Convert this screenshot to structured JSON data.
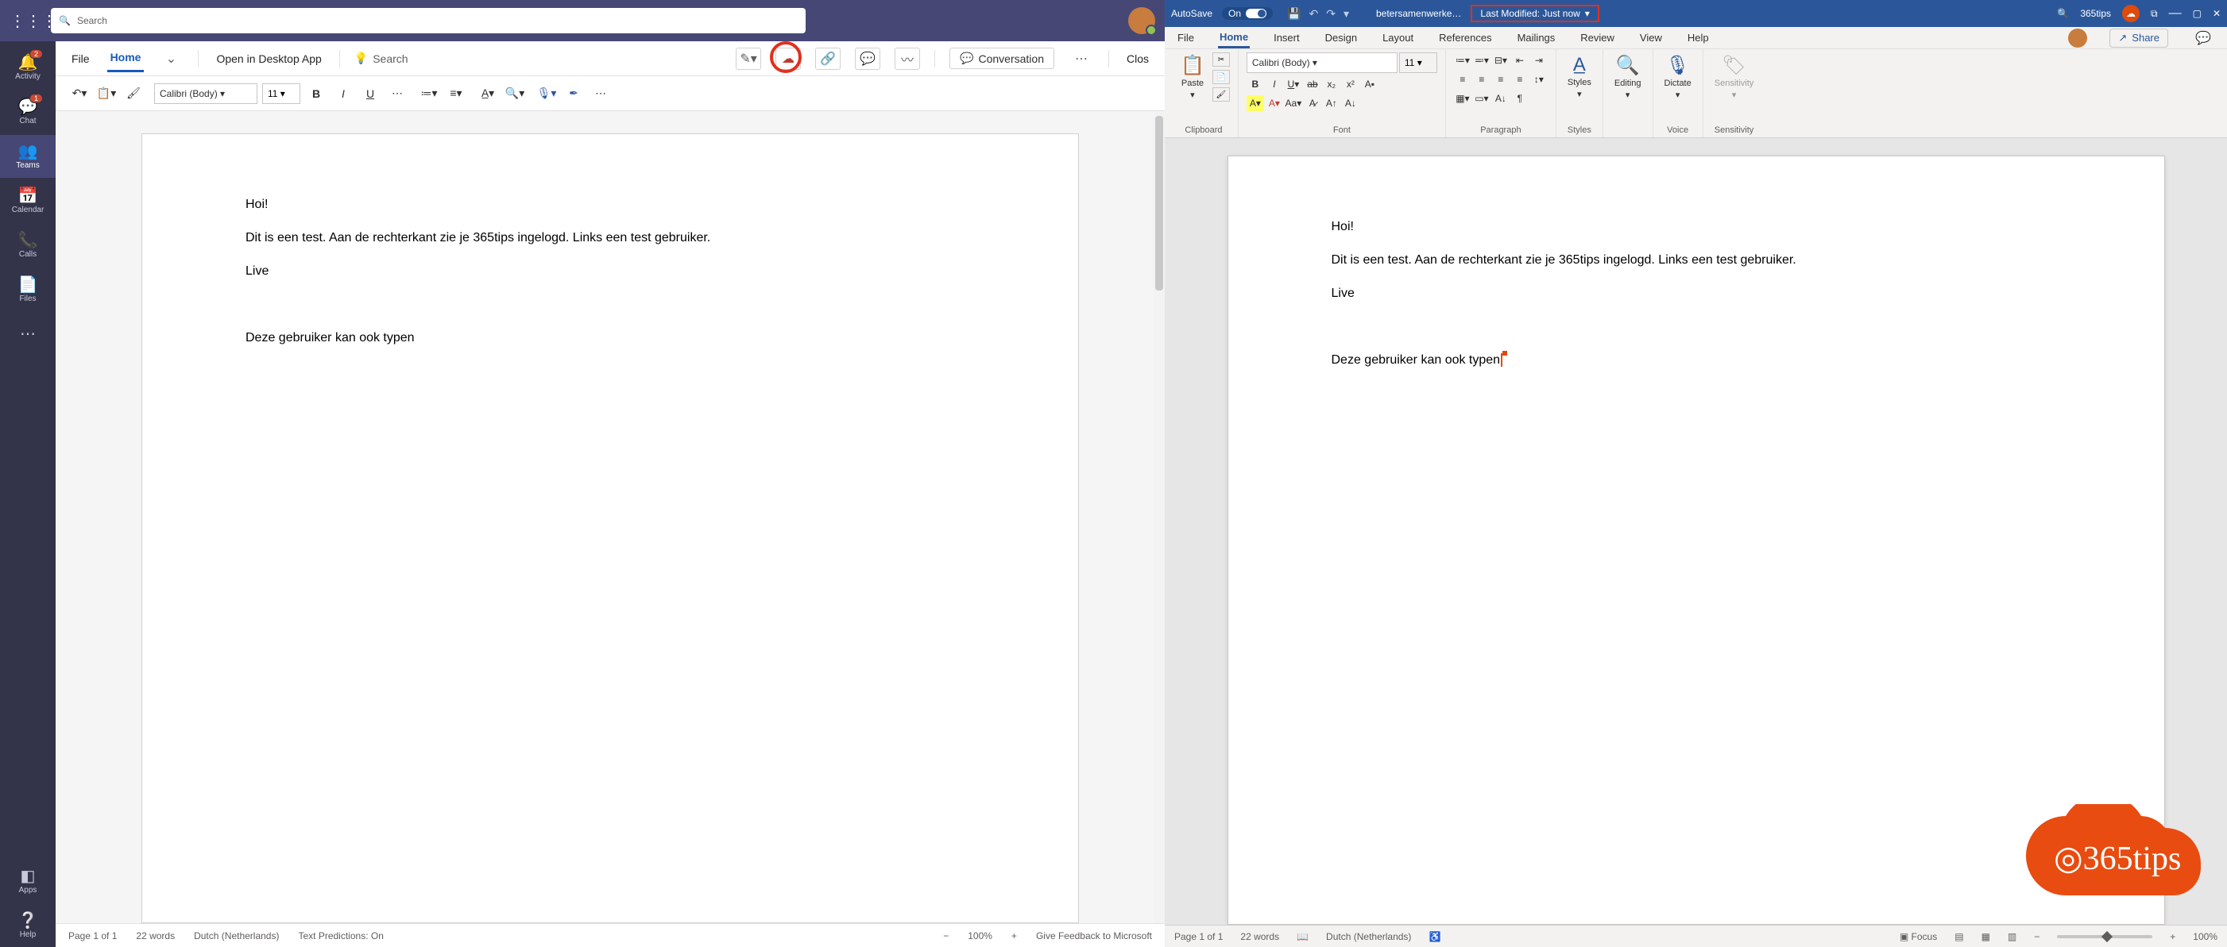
{
  "teams": {
    "search_placeholder": "Search",
    "rail": {
      "activity": "Activity",
      "activity_badge": "2",
      "chat": "Chat",
      "chat_badge": "1",
      "teams": "Teams",
      "calendar": "Calendar",
      "calls": "Calls",
      "files": "Files",
      "apps": "Apps",
      "help": "Help"
    },
    "commandbar": {
      "file": "File",
      "home": "Home",
      "open_desktop": "Open in Desktop App",
      "search": "Search",
      "conversation": "Conversation",
      "close": "Clos"
    },
    "toolbar": {
      "font_name": "Calibri (Body)",
      "font_size": "11"
    },
    "document": {
      "p1": "Hoi!",
      "p2": "Dit is een test. Aan de rechterkant zie je 365tips ingelogd. Links een test gebruiker.",
      "p3": "Live",
      "p4": "Deze gebruiker kan ook typen"
    },
    "status": {
      "page": "Page 1 of 1",
      "words": "22 words",
      "lang": "Dutch (Netherlands)",
      "predictions": "Text Predictions: On",
      "zoom_minus": "−",
      "zoom": "100%",
      "zoom_plus": "+",
      "feedback": "Give Feedback to Microsoft"
    }
  },
  "word": {
    "titlebar": {
      "autosave": "AutoSave",
      "autosave_state": "On",
      "docname": "betersamenwerke…",
      "lastmod": "Last Modified: Just now",
      "user": "365tips"
    },
    "tabs": {
      "file": "File",
      "home": "Home",
      "insert": "Insert",
      "design": "Design",
      "layout": "Layout",
      "references": "References",
      "mailings": "Mailings",
      "review": "Review",
      "view": "View",
      "help": "Help",
      "share": "Share"
    },
    "ribbon": {
      "paste": "Paste",
      "clipboard": "Clipboard",
      "font_name": "Calibri (Body)",
      "font_size": "11",
      "font": "Font",
      "paragraph": "Paragraph",
      "styles": "Styles",
      "editing": "Editing",
      "dictate": "Dictate",
      "voice": "Voice",
      "sensitivity": "Sensitivity"
    },
    "document": {
      "p1": "Hoi!",
      "p2": "Dit is een test. Aan de rechterkant zie je 365tips ingelogd. Links een test gebruiker.",
      "p3": "Live",
      "p4": "Deze gebruiker kan ook typen"
    },
    "status": {
      "page": "Page 1 of 1",
      "words": "22 words",
      "lang": "Dutch (Netherlands)",
      "focus": "Focus",
      "zoom": "100%"
    },
    "logo_text": "365tips"
  }
}
